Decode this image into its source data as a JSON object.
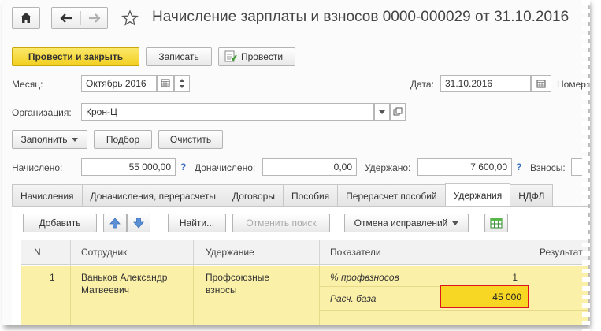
{
  "window": {
    "title": "Начисление зарплаты и взносов 0000-000029 от 31.10.2016"
  },
  "toolbar": {
    "post_close": "Провести и закрыть",
    "save": "Записать",
    "post": "Провести"
  },
  "header": {
    "month_label": "Месяц:",
    "month_value": "Октябрь 2016",
    "date_label": "Дата:",
    "date_value": "31.10.2016",
    "number_label": "Номер:",
    "org_label": "Организация:",
    "org_value": "Крон-Ц"
  },
  "fill_bar": {
    "fill": "Заполнить",
    "select": "Подбор",
    "clear": "Очистить"
  },
  "totals": {
    "accrued_label": "Начислено:",
    "accrued_value": "55 000,00",
    "extra_label": "Доначислено:",
    "extra_value": "0,00",
    "withheld_label": "Удержано:",
    "withheld_value": "7 600,00",
    "contrib_label": "Взносы:",
    "help": "?"
  },
  "tabs": [
    {
      "label": "Начисления"
    },
    {
      "label": "Доначисления, перерасчеты"
    },
    {
      "label": "Договоры"
    },
    {
      "label": "Пособия"
    },
    {
      "label": "Перерасчет пособий"
    },
    {
      "label": "Удержания"
    },
    {
      "label": "НДФЛ"
    }
  ],
  "table_toolbar": {
    "add": "Добавить",
    "find": "Найти...",
    "cancel_search": "Отменить поиск",
    "undo_fixes": "Отмена исправлений"
  },
  "table": {
    "columns": [
      "N",
      "Сотрудник",
      "Удержание",
      "Показатели",
      "Результат"
    ],
    "row": {
      "n": "1",
      "employee_line1": "Ваньков Александр",
      "employee_line2": "Матвеевич",
      "deduction_line1": "Профсоюзные",
      "deduction_line2": "взносы",
      "indicator1_name": "% профвзносов",
      "indicator1_value": "1",
      "indicator2_name": "Расч. база",
      "indicator2_value": "45 000"
    }
  },
  "colors": {
    "primary_button": "#f2cf21",
    "row_highlight": "#fbf0a8",
    "highlight_border": "#e0141e",
    "help_link": "#3c6fbf"
  }
}
